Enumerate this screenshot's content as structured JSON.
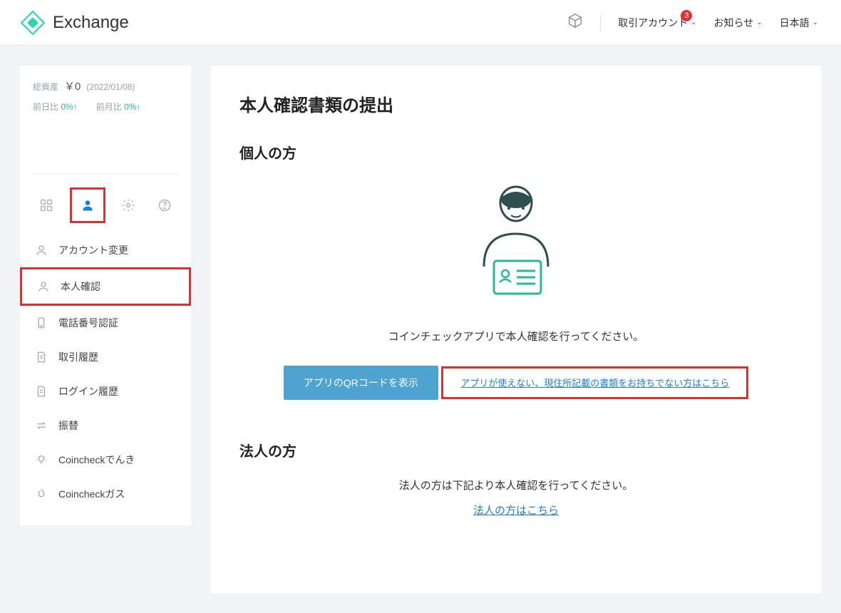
{
  "header": {
    "brand": "Exchange",
    "account_menu": "取引アカウント",
    "badge_count": "3",
    "notices": "お知らせ",
    "language": "日本語"
  },
  "sidebar": {
    "stats": {
      "total_label": "総資産",
      "total_value": "￥0",
      "date": "(2022/01/08)",
      "dod_label": "前日比",
      "dod_value": "0%↑",
      "mom_label": "前月比",
      "mom_value": "0%↑"
    },
    "menu": {
      "account_change": "アカウント変更",
      "identity": "本人確認",
      "phone": "電話番号認証",
      "trade_history": "取引履歴",
      "login_history": "ログイン履歴",
      "transfer": "振替",
      "denki": "Coincheckでんき",
      "gas": "Coincheckガス"
    }
  },
  "main": {
    "title": "本人確認書類の提出",
    "individual": {
      "heading": "個人の方",
      "instruction": "コインチェックアプリで本人確認を行ってください。",
      "qr_button": "アプリのQRコードを表示",
      "alt_link": "アプリが使えない、現住所記載の書類をお持ちでない方はこちら"
    },
    "corporate": {
      "heading": "法人の方",
      "instruction": "法人の方は下記より本人確認を行ってください。",
      "link": "法人の方はこちら"
    }
  }
}
